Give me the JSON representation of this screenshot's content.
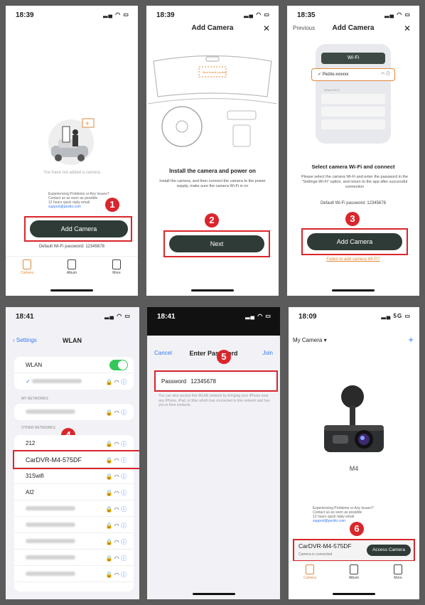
{
  "colors": {
    "accent_red": "#d9262c",
    "button_dark": "#2e3b36",
    "ios_blue": "#3478f6",
    "orange": "#e08a3a",
    "toggle_green": "#34c759"
  },
  "screen1": {
    "time": "18:39",
    "empty_text": "You have not added a camera",
    "help_lines": [
      "Experiencing Problems or Any Issues?",
      "Contact us as soon as possible",
      "12 hours quick reply email",
      "support@peztio.com"
    ],
    "badge": "1",
    "button": "Add Camera",
    "default_pw": "Default Wi-Fi password: 12345678",
    "tabs": [
      "Camera",
      "Album",
      "More"
    ]
  },
  "screen2": {
    "time": "18:39",
    "title": "Add Camera",
    "close": "✕",
    "hint": "Best install position",
    "heading": "Install the camera and power on",
    "desc": "Install the camera, and then connect the camera to the power supply, make sure the camera Wi-Fi is on",
    "badge": "2",
    "button": "Next"
  },
  "screen3": {
    "time": "18:35",
    "back": "Previous",
    "title": "Add Camera",
    "close": "✕",
    "wifi_title": "Wi-Fi",
    "network": "Peztio-xxxxxx",
    "select_label": "Select Wi-Fi",
    "heading": "Select camera Wi-Fi and connect",
    "desc": "Please select the camera Wi-Fi and enter the password in the \"Settings-Wi-Fi\" option, and return to the app after successful connection",
    "default_pw": "Default Wi-Fi password: 12345678",
    "badge": "3",
    "button": "Add Camera",
    "fail_link": "Failed to add camera Wi-Fi?"
  },
  "screen4": {
    "time": "18:41",
    "back": "Settings",
    "title": "WLAN",
    "wlan_label": "WLAN",
    "my_networks": "MY NETWORKS",
    "other_networks": "OTHER NETWORKS",
    "badge": "4",
    "networks": [
      "212",
      "CarDVR-M4-575DF",
      "31Swifi",
      "AI2"
    ]
  },
  "screen5": {
    "time": "18:41",
    "cancel": "Cancel",
    "title": "Enter Password",
    "join": "Join",
    "badge": "5",
    "pw_label": "Password",
    "pw_value": "12345678",
    "hint": "You can also access this WLAN network by bringing your iPhone near any iPhone, iPad, or Mac which has connected to this network and has you in their contacts."
  },
  "screen6": {
    "time": "18:09",
    "my_camera": "My Camera ▾",
    "plus": "+",
    "model": "M4",
    "help_lines": [
      "Experiencing Problems or Any Issues?",
      "Contact us as soon as possible",
      "12 hours quick reply email",
      "support@peztio.com"
    ],
    "badge": "6",
    "device": "CarDVR-M4-575DF",
    "status": "Camera is connected",
    "button": "Access Camera",
    "tabs": [
      "Camera",
      "Album",
      "More"
    ]
  }
}
